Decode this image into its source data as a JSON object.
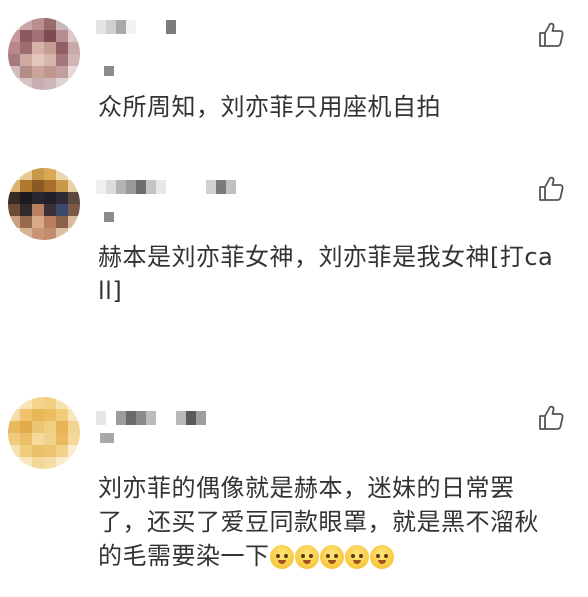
{
  "comments": [
    {
      "text": "众所周知，刘亦菲只用座机自拍",
      "like_icon": "thumbs-up-icon"
    },
    {
      "text": "赫本是刘亦菲女神，刘亦菲是我女神[打call]",
      "like_icon": "thumbs-up-icon"
    },
    {
      "text": "刘亦菲的偶像就是赫本，迷妹的日常罢了，还买了爱豆同款眼罩，就是黑不溜秋的毛需要染一下",
      "emoji_name": "doge-emoji",
      "emoji_count": 5,
      "like_icon": "thumbs-up-icon"
    }
  ],
  "colors": {
    "text": "#333333",
    "background": "#ffffff",
    "icon": "#555555",
    "blur": "#8c8c8c"
  }
}
